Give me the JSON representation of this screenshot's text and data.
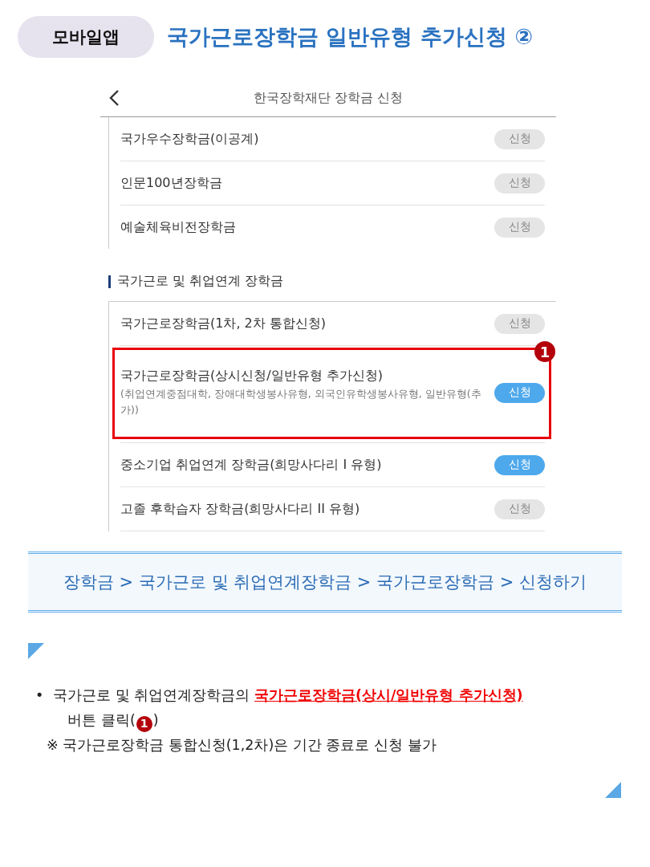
{
  "header": {
    "tag": "모바일앱",
    "title": "국가근로장학금 일반유형 추가신청 ②"
  },
  "phone": {
    "title": "한국장학재단 장학금 신청",
    "top_items": [
      {
        "name": "국가우수장학금(이공계)",
        "button": "신청",
        "active": false
      },
      {
        "name": "인문100년장학금",
        "button": "신청",
        "active": false
      },
      {
        "name": "예술체육비전장학금",
        "button": "신청",
        "active": false
      }
    ],
    "section_title": "국가근로 및 취업연계 장학금",
    "items": [
      {
        "name": "국가근로장학금(1차, 2차 통합신청)",
        "button": "신청",
        "active": false,
        "highlighted": false
      },
      {
        "name": "국가근로장학금(상시신청/일반유형 추가신청)",
        "sub": "(취업연계중점대학, 장애대학생봉사유형, 외국인유학생봉사유형, 일반유형(추가))",
        "button": "신청",
        "active": true,
        "highlighted": true,
        "badge": "1"
      },
      {
        "name": "중소기업 취업연계 장학금(희망사다리 I 유형)",
        "button": "신청",
        "active": true,
        "highlighted": false
      },
      {
        "name": "고졸 후학습자 장학금(희망사다리 II 유형)",
        "button": "신청",
        "active": false,
        "highlighted": false
      }
    ]
  },
  "breadcrumb": "장학금 > 국가근로 및 취업연계장학금 > 국가근로장학금 > 신청하기",
  "notes": [
    {
      "kind": "bullet",
      "marker": "•",
      "text": "국가근로 및 취업연계장학금의 **국가근로장학금(상시/일반유형 추가신청)**",
      "text2": "버튼 클릭(",
      "badge": "1",
      "after": ")"
    },
    {
      "kind": "remark",
      "text": "※ 국가근로장학금 통합신청(1,2차)은 기간 종료로 신청 불가"
    }
  ]
}
